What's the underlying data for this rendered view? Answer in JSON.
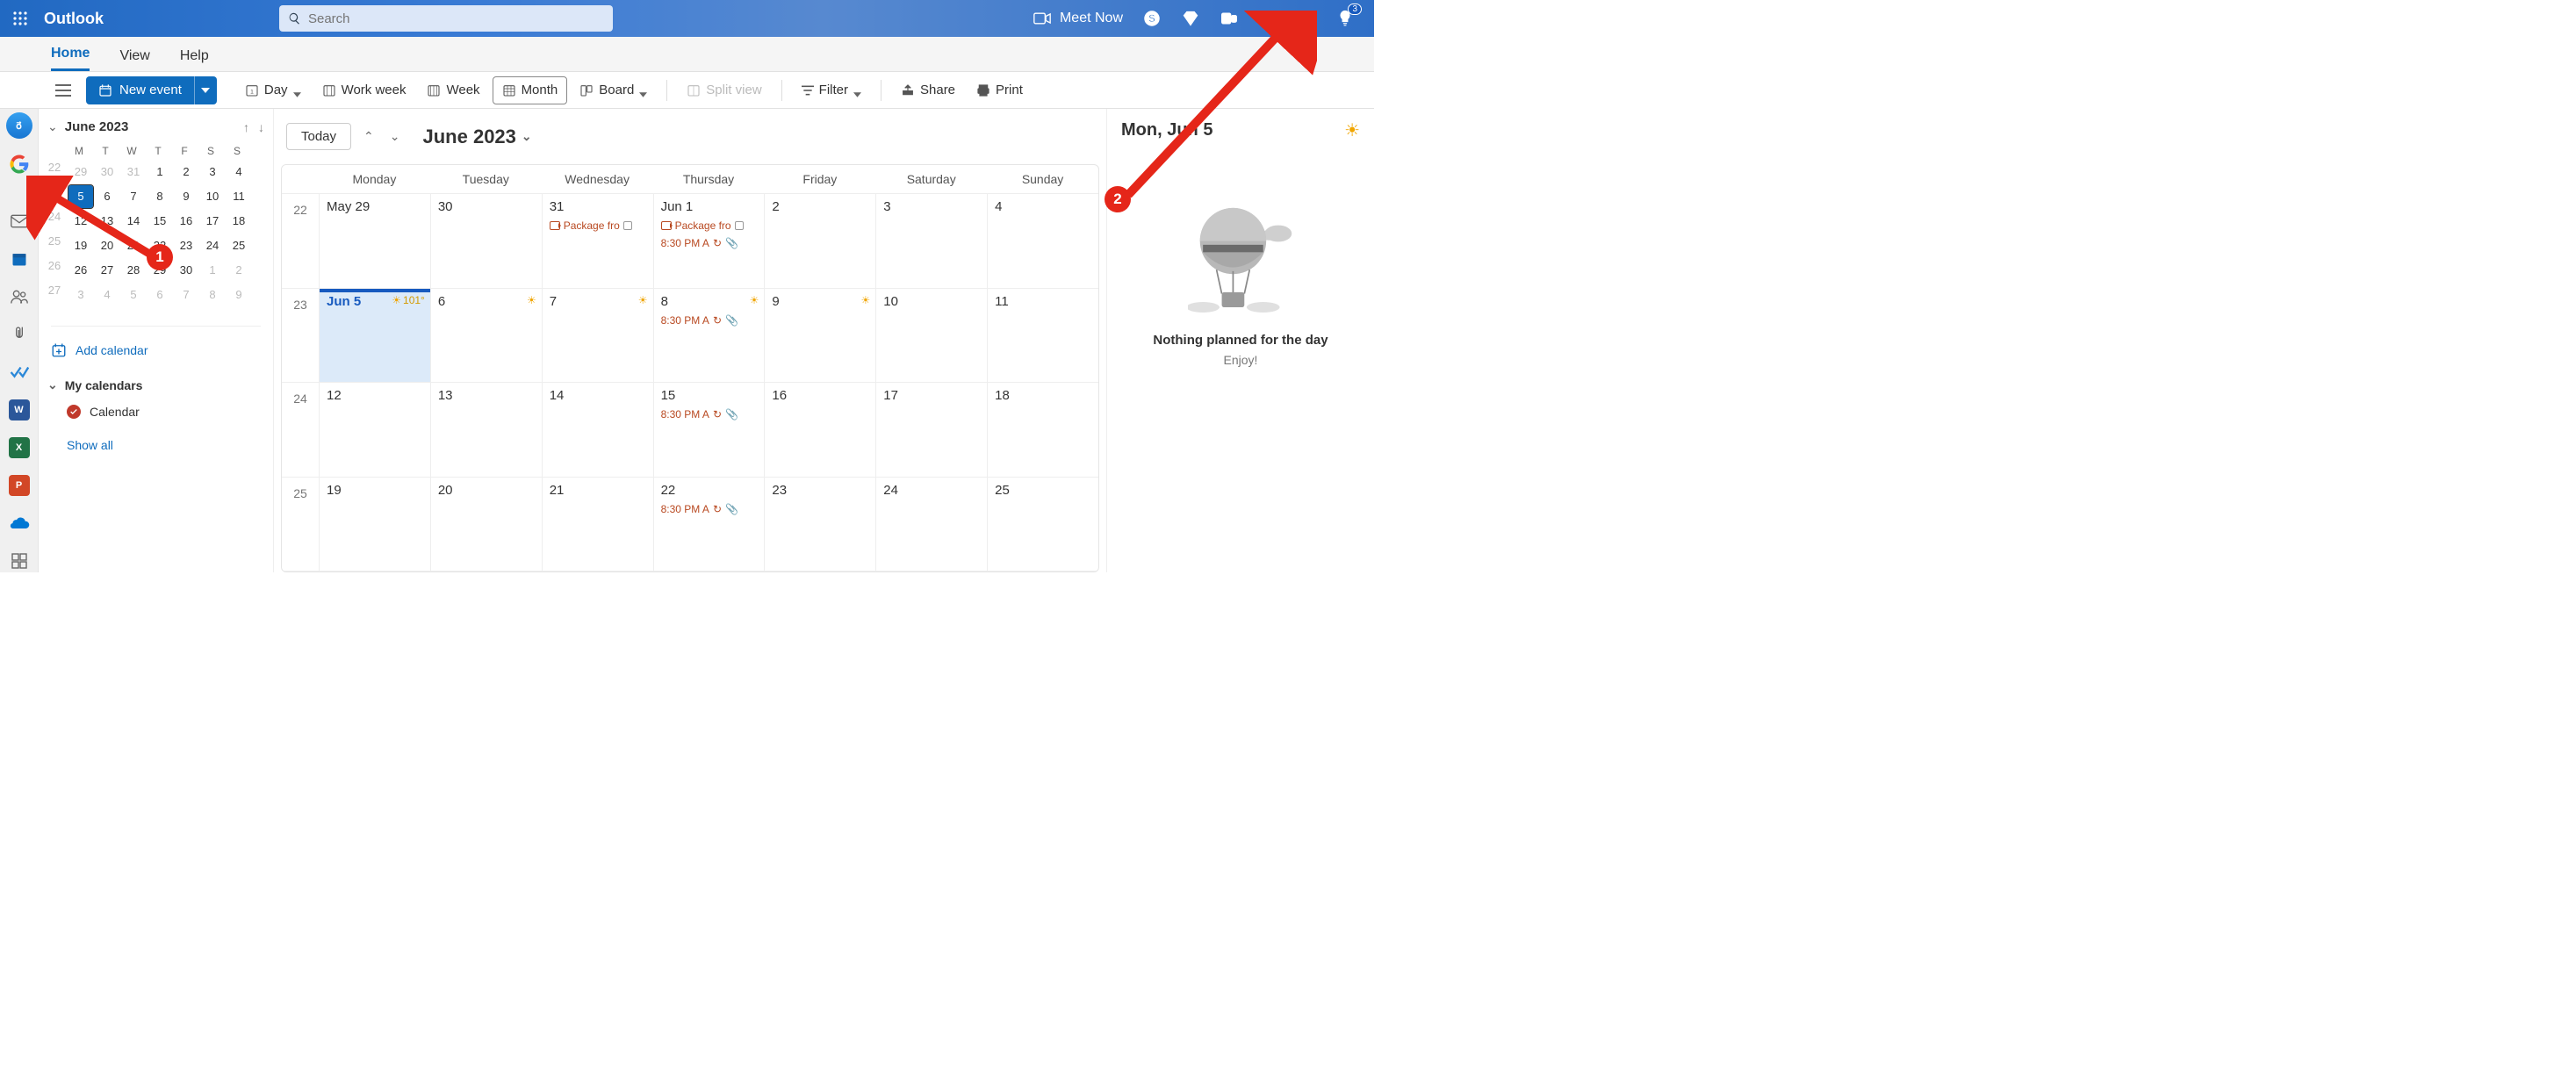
{
  "brand": "Outlook",
  "search": {
    "placeholder": "Search"
  },
  "top": {
    "meet_now": "Meet Now",
    "bell_badge": "3"
  },
  "tabs": {
    "home": "Home",
    "view": "View",
    "help": "Help"
  },
  "toolbar": {
    "new_event": "New event",
    "day": "Day",
    "workweek": "Work week",
    "week": "Week",
    "month": "Month",
    "board": "Board",
    "split": "Split view",
    "filter": "Filter",
    "share": "Share",
    "print": "Print"
  },
  "sidebar": {
    "month": "June 2023",
    "dow": [
      "M",
      "T",
      "W",
      "T",
      "F",
      "S",
      "S"
    ],
    "weeks": [
      {
        "wk": "22",
        "days": [
          {
            "n": "29",
            "o": true
          },
          {
            "n": "30",
            "o": true
          },
          {
            "n": "31",
            "o": true
          },
          {
            "n": "1"
          },
          {
            "n": "2"
          },
          {
            "n": "3"
          },
          {
            "n": "4"
          }
        ]
      },
      {
        "wk": "23",
        "days": [
          {
            "n": "5",
            "today": true
          },
          {
            "n": "6"
          },
          {
            "n": "7"
          },
          {
            "n": "8"
          },
          {
            "n": "9"
          },
          {
            "n": "10"
          },
          {
            "n": "11"
          }
        ]
      },
      {
        "wk": "24",
        "days": [
          {
            "n": "12"
          },
          {
            "n": "13"
          },
          {
            "n": "14"
          },
          {
            "n": "15"
          },
          {
            "n": "16"
          },
          {
            "n": "17"
          },
          {
            "n": "18"
          }
        ]
      },
      {
        "wk": "25",
        "days": [
          {
            "n": "19"
          },
          {
            "n": "20"
          },
          {
            "n": "21"
          },
          {
            "n": "22"
          },
          {
            "n": "23"
          },
          {
            "n": "24"
          },
          {
            "n": "25"
          }
        ]
      },
      {
        "wk": "26",
        "days": [
          {
            "n": "26"
          },
          {
            "n": "27"
          },
          {
            "n": "28"
          },
          {
            "n": "29"
          },
          {
            "n": "30"
          },
          {
            "n": "1",
            "o": true
          },
          {
            "n": "2",
            "o": true
          }
        ]
      },
      {
        "wk": "27",
        "days": [
          {
            "n": "3",
            "o": true
          },
          {
            "n": "4",
            "o": true
          },
          {
            "n": "5",
            "o": true
          },
          {
            "n": "6",
            "o": true
          },
          {
            "n": "7",
            "o": true
          },
          {
            "n": "8",
            "o": true
          },
          {
            "n": "9",
            "o": true
          }
        ]
      }
    ],
    "add_cal": "Add calendar",
    "my_cal": "My calendars",
    "cal_item": "Calendar",
    "show_all": "Show all"
  },
  "main": {
    "today_btn": "Today",
    "title": "June 2023",
    "dow": [
      "Monday",
      "Tuesday",
      "Wednesday",
      "Thursday",
      "Friday",
      "Saturday",
      "Sunday"
    ],
    "rows": [
      {
        "wk": "22",
        "days": [
          {
            "num": "May 29"
          },
          {
            "num": "30"
          },
          {
            "num": "31",
            "evts": [
              {
                "t": "Package fro",
                "cam": true,
                "lock": true
              }
            ]
          },
          {
            "num": "Jun 1",
            "evts": [
              {
                "t": "Package fro",
                "cam": true,
                "lock": true
              },
              {
                "t": "8:30 PM  A",
                "rec": true,
                "att": true
              }
            ]
          },
          {
            "num": "2"
          },
          {
            "num": "3"
          },
          {
            "num": "4"
          }
        ]
      },
      {
        "wk": "23",
        "days": [
          {
            "num": "Jun 5",
            "today": true,
            "weather": "101°"
          },
          {
            "num": "6",
            "weather": ""
          },
          {
            "num": "7",
            "weather": ""
          },
          {
            "num": "8",
            "weather": "",
            "evts": [
              {
                "t": "8:30 PM  A",
                "rec": true,
                "att": true
              }
            ]
          },
          {
            "num": "9",
            "weather": ""
          },
          {
            "num": "10"
          },
          {
            "num": "11"
          }
        ]
      },
      {
        "wk": "24",
        "days": [
          {
            "num": "12"
          },
          {
            "num": "13"
          },
          {
            "num": "14"
          },
          {
            "num": "15",
            "evts": [
              {
                "t": "8:30 PM  A",
                "rec": true,
                "att": true
              }
            ]
          },
          {
            "num": "16"
          },
          {
            "num": "17"
          },
          {
            "num": "18"
          }
        ]
      },
      {
        "wk": "25",
        "days": [
          {
            "num": "19"
          },
          {
            "num": "20"
          },
          {
            "num": "21"
          },
          {
            "num": "22",
            "evts": [
              {
                "t": "8:30 PM  A",
                "rec": true,
                "att": true
              }
            ]
          },
          {
            "num": "23"
          },
          {
            "num": "24"
          },
          {
            "num": "25"
          }
        ]
      }
    ]
  },
  "right": {
    "title": "Mon, Jun 5",
    "empty_msg": "Nothing planned for the day",
    "empty_sub": "Enjoy!"
  },
  "annot": {
    "n1": "1",
    "n2": "2"
  }
}
